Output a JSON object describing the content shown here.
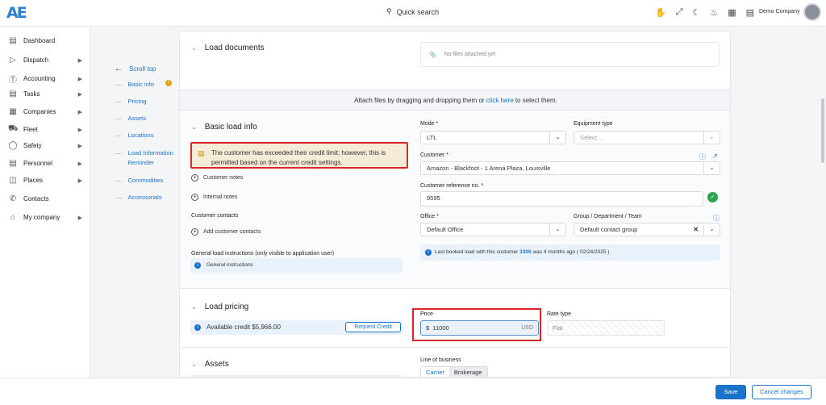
{
  "topbar": {
    "logo": "AE",
    "search_label": "Quick search",
    "company": "Demo Company",
    "icons": [
      "hand-icon",
      "expand-icon",
      "moon-icon",
      "bell-icon",
      "grid-icon",
      "calendar-icon"
    ]
  },
  "sidebar": {
    "items": [
      {
        "label": "Dashboard",
        "icon": "bar-chart-icon",
        "has_children": false
      },
      {
        "label": "Dispatch",
        "icon": "send-icon",
        "has_children": true
      },
      {
        "label": "Accounting",
        "icon": "dollar-icon",
        "has_children": true
      },
      {
        "label": "Tasks",
        "icon": "clipboard-icon",
        "has_children": true
      },
      {
        "label": "Companies",
        "icon": "building-icon",
        "has_children": true
      },
      {
        "label": "Fleet",
        "icon": "truck-icon",
        "has_children": true
      },
      {
        "label": "Safety",
        "icon": "shield-icon",
        "has_children": true
      },
      {
        "label": "Personnel",
        "icon": "id-card-icon",
        "has_children": true
      },
      {
        "label": "Places",
        "icon": "map-icon",
        "has_children": true
      },
      {
        "label": "Contacts",
        "icon": "phone-icon",
        "has_children": false
      },
      {
        "label": "My company",
        "icon": "home-icon",
        "has_children": true
      }
    ]
  },
  "anchor_nav": {
    "back_label": "Scroll top",
    "links": [
      "Basic info",
      "Pricing",
      "Assets",
      "Locations",
      "Load Information Reminder",
      "Commodities",
      "Accessorials"
    ]
  },
  "load_documents": {
    "title": "Load documents",
    "no_files": "No files attached yet",
    "attach_text_before": "Attach files by dragging and dropping them or",
    "attach_link": "click here",
    "attach_text_after": "to select them."
  },
  "basic_info": {
    "title": "Basic load info",
    "credit_alert": "The customer has exceeded their credit limit; however, this is permitted based on the current credit settings.",
    "customer_notes": "Customer notes",
    "internal_notes": "Internal notes",
    "customer_contacts_label": "Customer contacts",
    "add_contacts": "Add customer contacts",
    "general_instructions_label": "General load instructions (only visible to application user)",
    "general_instructions_btn": "General instructions",
    "mode_label": "Mode *",
    "mode_value": "LTL",
    "equipment_label": "Equipment type",
    "equipment_placeholder": "Select...",
    "customer_label": "Customer *",
    "customer_value": "Amazon - Blackfoot - 1 Arena Plaza, Louisville",
    "ref_label": "Customer reference no. *",
    "ref_value": "9595",
    "office_label": "Office *",
    "office_value": "Default Office",
    "group_label": "Group / Department / Team",
    "group_value": "Default contact group",
    "last_booked_before": "Last booked load with this customer",
    "last_booked_num": "3305",
    "last_booked_after": "was 4 months ago ( 02/24/2025 )."
  },
  "pricing": {
    "title": "Load pricing",
    "available_credit": "Available credit $5,966.00",
    "request_credit": "Request Credit",
    "price_label": "Price",
    "price_prefix": "$",
    "price_value": "11000",
    "price_currency": "USD",
    "rate_type_label": "Rate type",
    "rate_type_value": "Flat"
  },
  "assets": {
    "title": "Assets",
    "lob_label": "Line of business",
    "lob_options": [
      "Carrier",
      "Brokerage"
    ]
  },
  "footer": {
    "save": "Save",
    "cancel": "Cancel changes"
  }
}
